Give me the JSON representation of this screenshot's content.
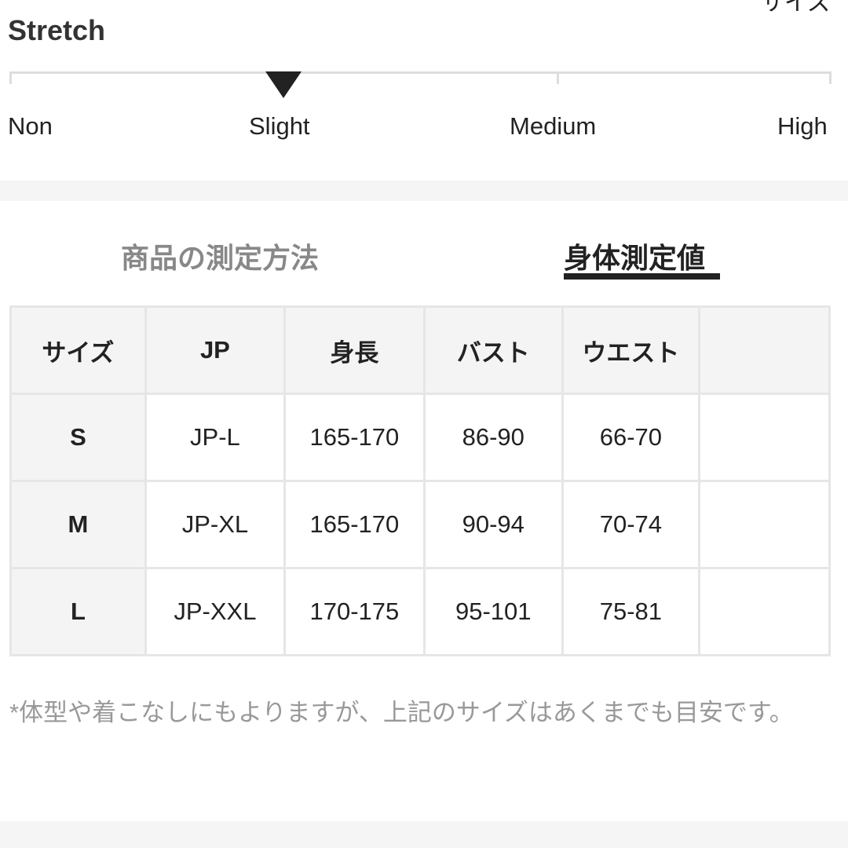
{
  "header_partial": "サイズ",
  "stretch": {
    "title": "Stretch",
    "levels": [
      "Non",
      "Slight",
      "Medium",
      "High"
    ],
    "selected": "Slight"
  },
  "tabs": [
    {
      "label": "商品の測定方法",
      "active": false
    },
    {
      "label": "身体測定値",
      "active": true
    }
  ],
  "table": {
    "headers": [
      "サイズ",
      "JP",
      "身長",
      "バスト",
      "ウエスト"
    ],
    "rows": [
      [
        "S",
        "JP-L",
        "165-170",
        "86-90",
        "66-70"
      ],
      [
        "M",
        "JP-XL",
        "165-170",
        "90-94",
        "70-74"
      ],
      [
        "L",
        "JP-XXL",
        "170-175",
        "95-101",
        "75-81"
      ]
    ]
  },
  "note": "*体型や着こなしにもよりますが、上記のサイズはあくまでも目安です。"
}
